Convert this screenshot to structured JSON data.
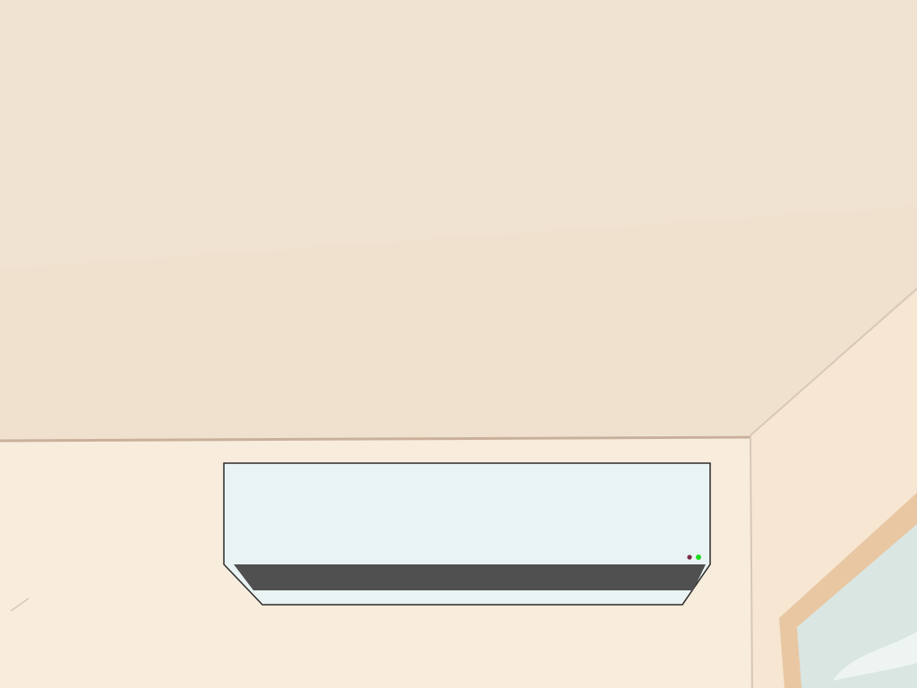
{
  "scene": {
    "colors": {
      "ceiling": "#f1e3d1",
      "ceiling_shade": "#ecdcc7",
      "wall": "#f8ecdd",
      "right_wall": "#f6e6d2",
      "molding_line": "#c9b09a",
      "corner_line": "#d8c8b8",
      "window_frame": "#e9c7a3",
      "window_glass": "#d9e6e2",
      "window_cloud": "#f3f7f5"
    },
    "air_conditioner": {
      "body_color": "#eaf3f3",
      "outline_color": "#2a2a2a",
      "vent_color": "#505050",
      "indicator_lights": [
        {
          "name": "power-indicator",
          "color": "#7a2a4a",
          "state": "off"
        },
        {
          "name": "status-indicator",
          "color": "#22dd22",
          "state": "on"
        }
      ]
    }
  }
}
